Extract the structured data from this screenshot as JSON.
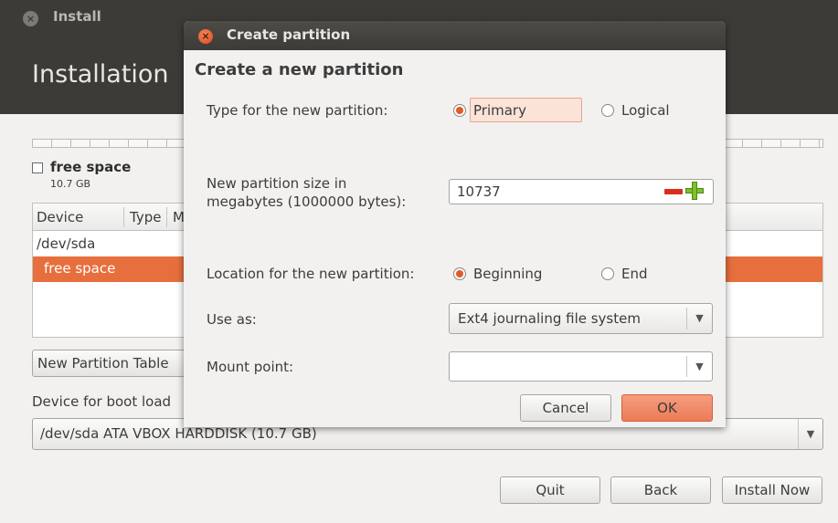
{
  "installer": {
    "window_title": "Install",
    "heading": "Installation",
    "legend": {
      "name": "free space",
      "size": "10.7 GB"
    },
    "table": {
      "columns": [
        "Device",
        "Type",
        "M"
      ],
      "rows": [
        {
          "label": "/dev/sda",
          "selected": false
        },
        {
          "label": "free space",
          "selected": true
        }
      ]
    },
    "new_partition_table_label": "New Partition Table",
    "boot_loader_label": "Device for boot load",
    "boot_device_value": "/dev/sda  ATA VBOX HARDDISK (10.7 GB)",
    "buttons": {
      "quit": "Quit",
      "back": "Back",
      "install_now": "Install Now"
    }
  },
  "dialog": {
    "title": "Create partition",
    "heading": "Create a new partition",
    "type_label": "Type for the new partition:",
    "type_options": [
      {
        "label": "Primary",
        "checked": true
      },
      {
        "label": "Logical",
        "checked": false
      }
    ],
    "size_label_line1": "New partition size in",
    "size_label_line2": "megabytes (1000000 bytes):",
    "size_value": "10737",
    "location_label": "Location for the new partition:",
    "location_options": [
      {
        "label": "Beginning",
        "checked": true
      },
      {
        "label": "End",
        "checked": false
      }
    ],
    "use_as_label": "Use as:",
    "use_as_value": "Ext4 journaling file system",
    "mount_label": "Mount point:",
    "mount_value": "",
    "cancel_label": "Cancel",
    "ok_label": "OK"
  },
  "colors": {
    "accent": "#e76f3d",
    "dark_bar": "#3c3b37",
    "window_bg": "#f2f1f0"
  },
  "icons": [
    "close-icon",
    "dialog-close-icon",
    "minus-icon",
    "plus-icon",
    "dropdown-arrow-icon"
  ]
}
